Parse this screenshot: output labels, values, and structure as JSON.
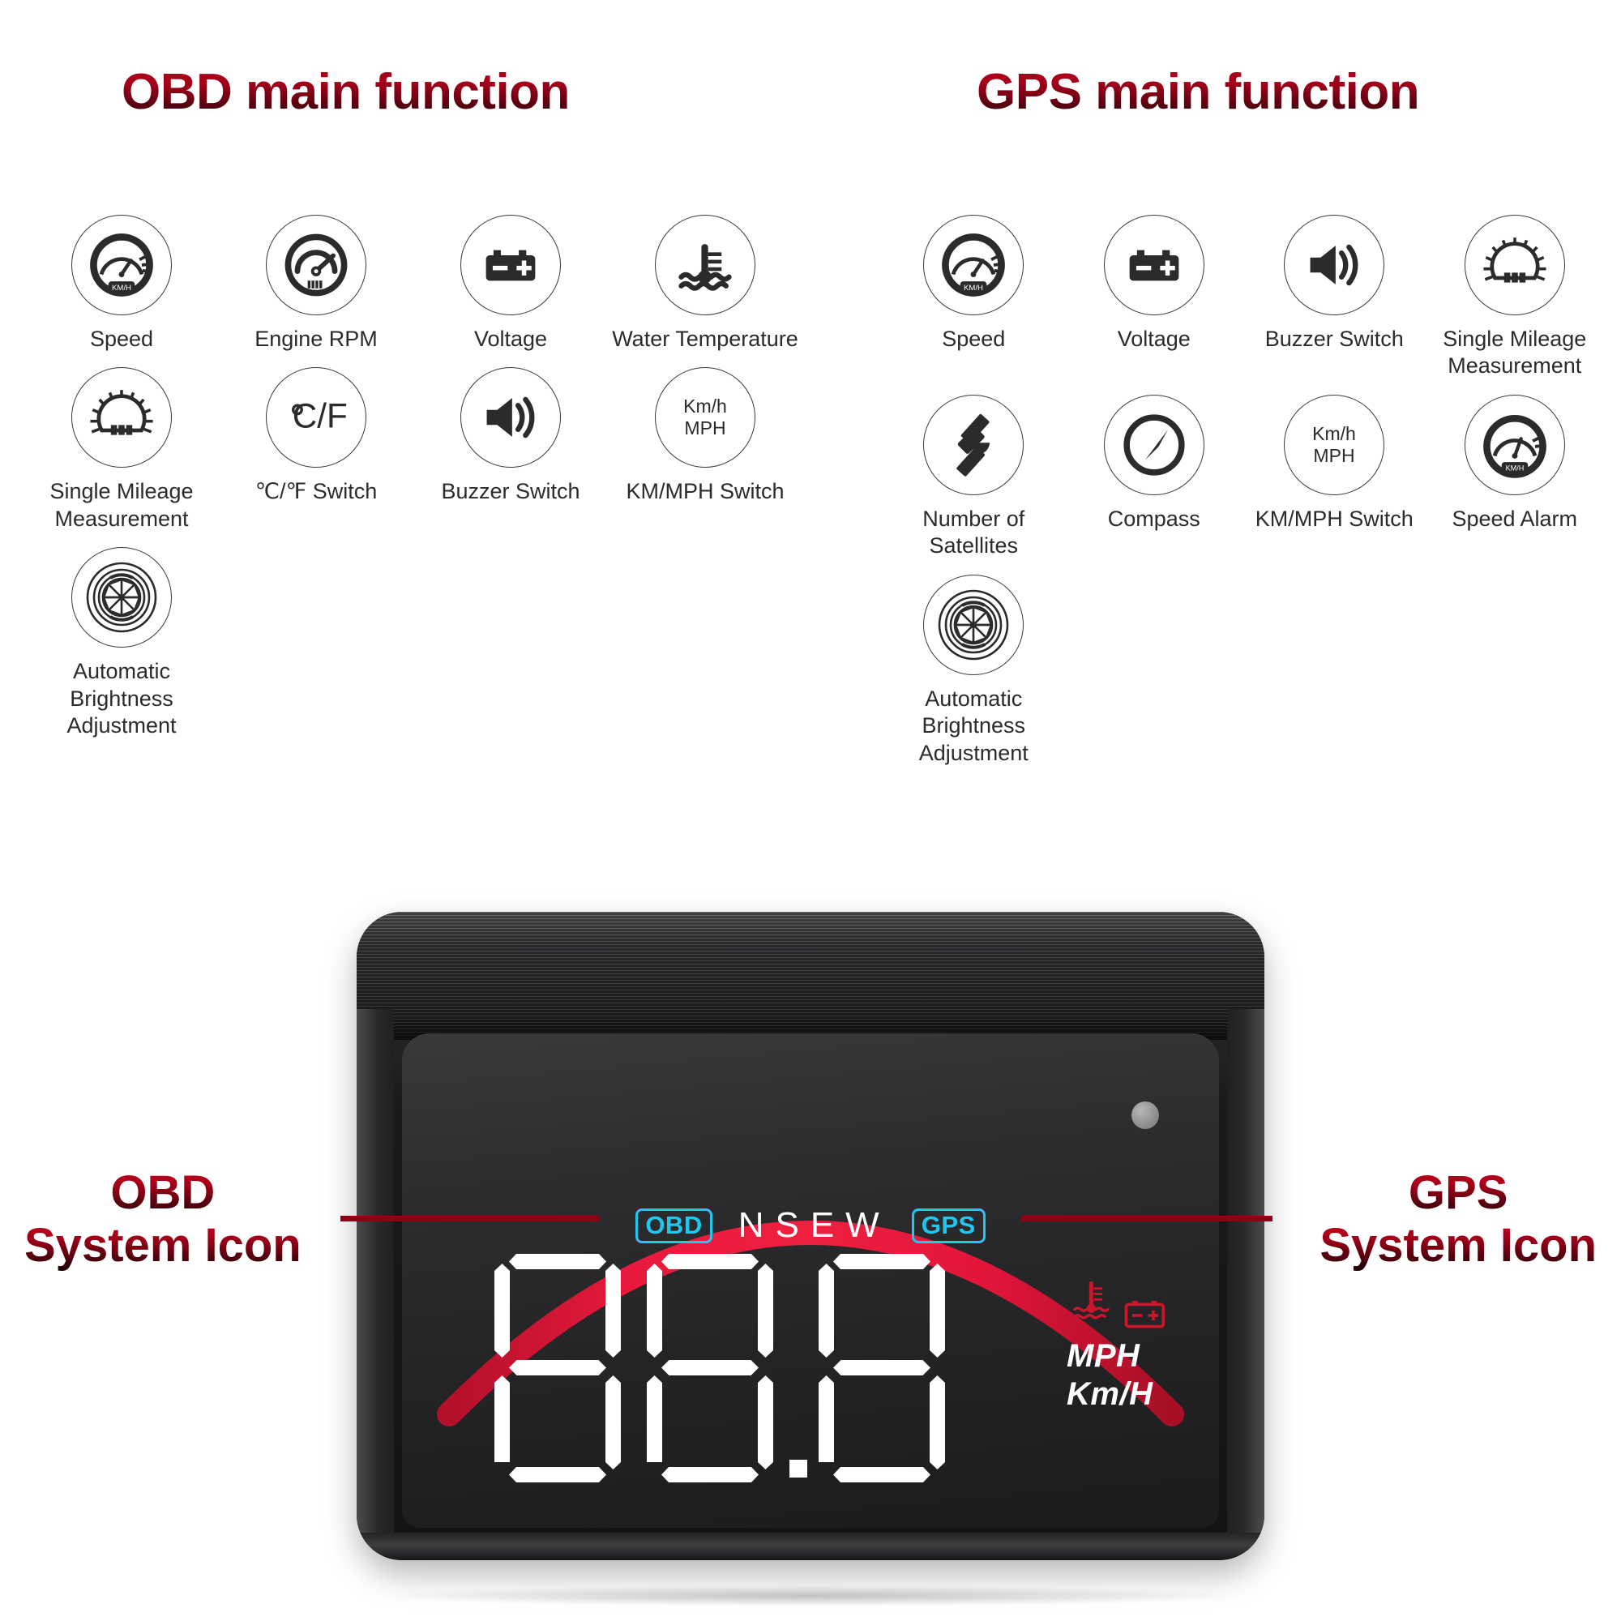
{
  "sections": {
    "obd": {
      "title": "OBD main function",
      "features": [
        {
          "label": "Speed",
          "icon": "speedometer-kmh-icon"
        },
        {
          "label": "Engine RPM",
          "icon": "tachometer-icon"
        },
        {
          "label": "Voltage",
          "icon": "battery-icon"
        },
        {
          "label": "Water Temperature",
          "icon": "water-temperature-icon"
        },
        {
          "label": "Single Mileage Measurement",
          "icon": "odometer-icon"
        },
        {
          "label": "℃/℉ Switch",
          "icon": "celsius-fahrenheit-icon"
        },
        {
          "label": "Buzzer Switch",
          "icon": "speaker-icon"
        },
        {
          "label": "KM/MPH Switch",
          "icon": "kmh-mph-icon"
        },
        {
          "label": "Automatic Brightness Adjustment",
          "icon": "aperture-icon"
        }
      ]
    },
    "gps": {
      "title": "GPS main function",
      "features": [
        {
          "label": "Speed",
          "icon": "speedometer-kmh-icon"
        },
        {
          "label": "Voltage",
          "icon": "battery-icon"
        },
        {
          "label": "Buzzer Switch",
          "icon": "speaker-icon"
        },
        {
          "label": "Single Mileage Measurement",
          "icon": "odometer-icon"
        },
        {
          "label": "Number of Satellites",
          "icon": "satellite-icon"
        },
        {
          "label": "Compass",
          "icon": "compass-icon"
        },
        {
          "label": "KM/MPH Switch",
          "icon": "kmh-mph-icon"
        },
        {
          "label": "Speed Alarm",
          "icon": "speed-alarm-icon"
        },
        {
          "label": "Automatic Brightness Adjustment",
          "icon": "aperture-icon"
        }
      ]
    }
  },
  "icon_text": {
    "speedometer_unit": "KM/H",
    "celsius_fahrenheit": "°C/F",
    "kmh": "Km/h",
    "mph": "MPH"
  },
  "device": {
    "display": {
      "obd_badge": "OBD",
      "gps_badge": "GPS",
      "compass_letters": "NSEW",
      "digits": "88.8",
      "unit_mph": "MPH",
      "unit_kmh": "Km/H",
      "temperature_indicator": "water-temperature-warning-icon",
      "battery_indicator": "battery-warning-icon"
    },
    "colors": {
      "arc_red": "#e8193c",
      "arc_orange": "#f59420",
      "badge_cyan": "#1ec8f0",
      "digit_white": "#ffffff",
      "indicator_red": "#c9162c"
    }
  },
  "callouts": {
    "left": {
      "line1": "OBD",
      "line2": "System Icon"
    },
    "right": {
      "line1": "GPS",
      "line2": "System Icon"
    }
  }
}
